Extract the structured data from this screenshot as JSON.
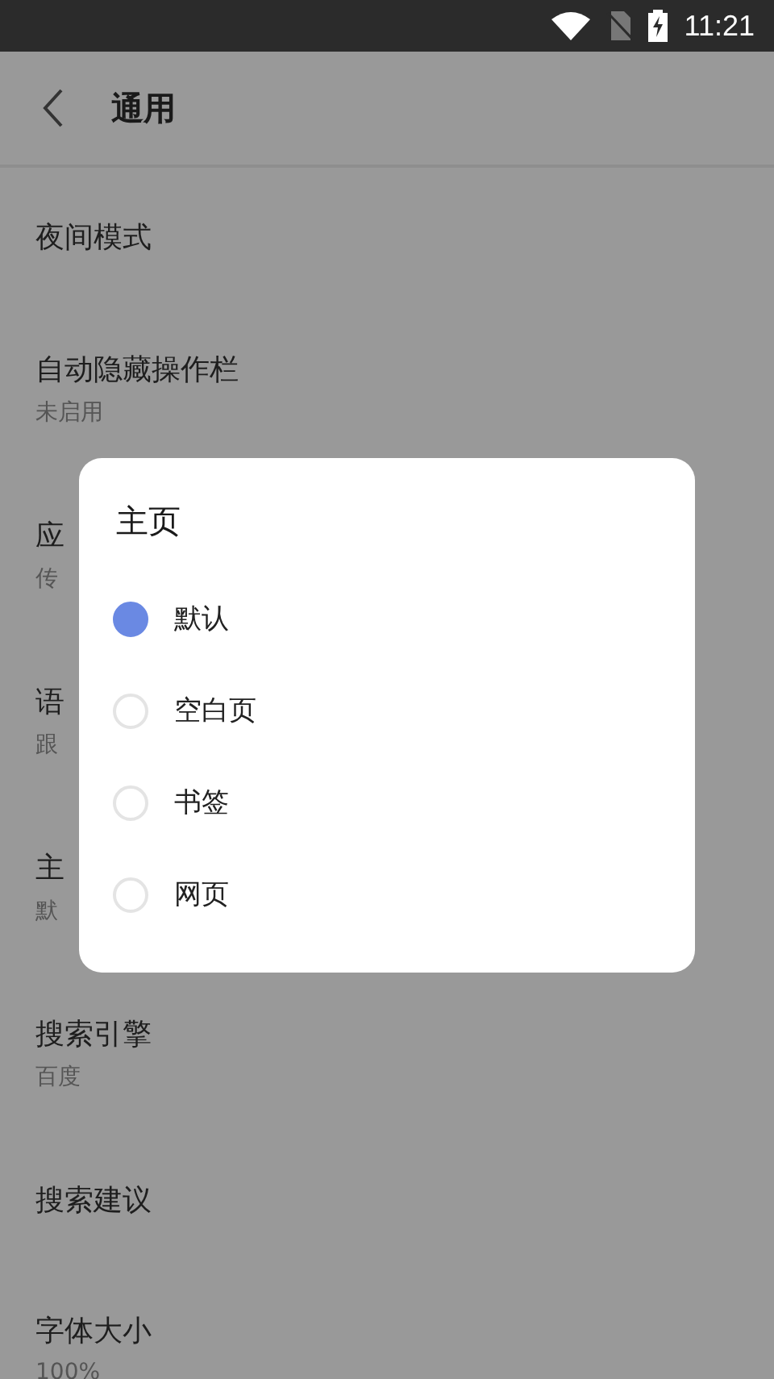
{
  "status_bar": {
    "time": "11:21"
  },
  "header": {
    "title": "通用"
  },
  "settings": [
    {
      "title": "夜间模式"
    },
    {
      "title": "自动隐藏操作栏",
      "subtitle": "未启用"
    },
    {
      "title": "应",
      "subtitle": "传"
    },
    {
      "title": "语",
      "subtitle": "跟"
    },
    {
      "title": "主",
      "subtitle": "默"
    },
    {
      "title": "搜索引擎",
      "subtitle": "百度"
    },
    {
      "title": "搜索建议"
    },
    {
      "title": "字体大小",
      "subtitle": "100%"
    }
  ],
  "dialog": {
    "title": "主页",
    "options": [
      {
        "label": "默认",
        "selected": true
      },
      {
        "label": "空白页",
        "selected": false
      },
      {
        "label": "书签",
        "selected": false
      },
      {
        "label": "网页",
        "selected": false
      }
    ]
  }
}
